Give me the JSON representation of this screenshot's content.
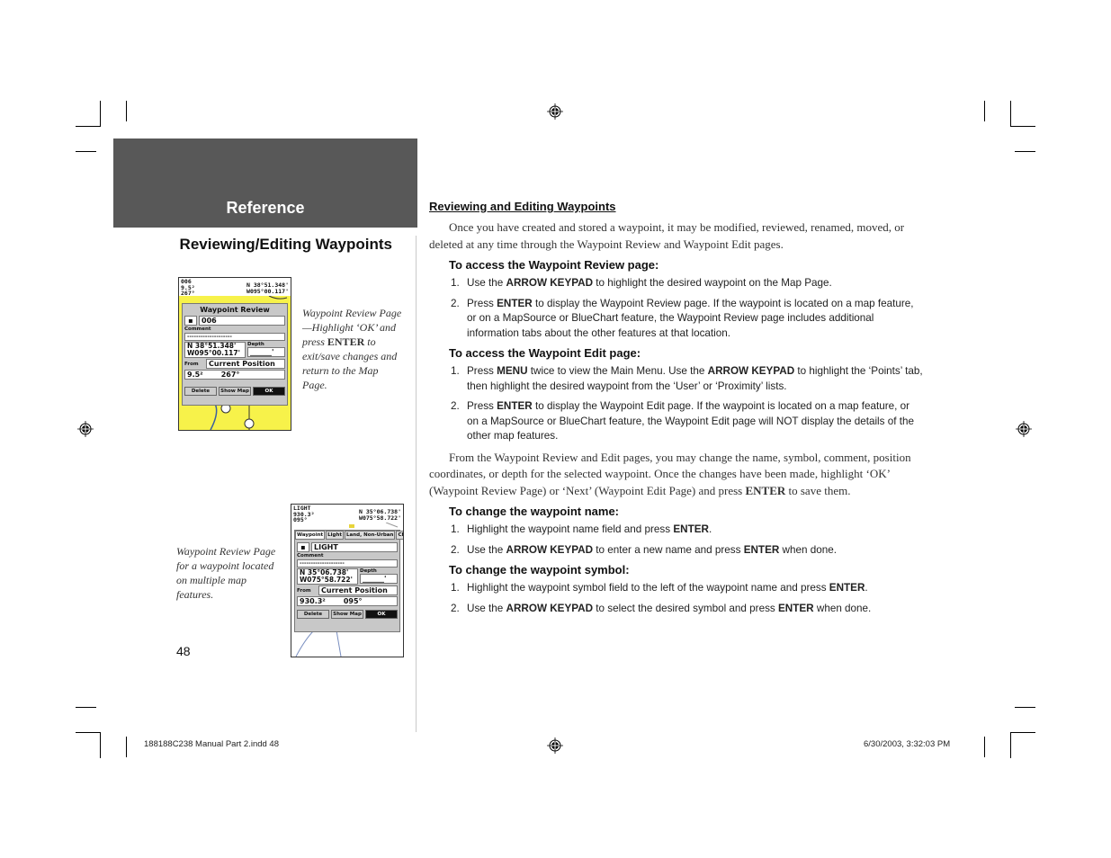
{
  "section_tab": {
    "label": "Reference"
  },
  "sidebar": {
    "heading": "Reviewing/Editing Waypoints",
    "figures": [
      {
        "caption_parts": [
          "Waypoint Review Page—Highlight ‘OK’ and press ",
          "ENTER",
          " to exit/save changes and return to the Map Page."
        ],
        "screen": {
          "header_left": [
            "006",
            "9.5²",
            "267°"
          ],
          "header_right": [
            "N 38°51.348'",
            "W095°00.117'"
          ],
          "title": "Waypoint Review",
          "symbol": "▪",
          "name": "006",
          "comment_label": "Comment",
          "comment_value": "--------------------",
          "coord_lat": "N  38°51.348'",
          "coord_lon": "W095°00.117'",
          "depth_label": "Depth",
          "depth_value": "______'",
          "from_label": "From",
          "from_value": "Current Position",
          "distance": "9.5²",
          "bearing": "267°",
          "buttons": [
            "Delete",
            "Show Map",
            "OK"
          ],
          "map_color": "#f7f24a"
        }
      },
      {
        "caption": "Waypoint Review Page for a waypoint located on multiple map features.",
        "screen": {
          "header_left": [
            "LIGHT",
            "930.3²",
            "095°"
          ],
          "header_right": [
            "N 35°06.738'",
            "W075°58.722'"
          ],
          "tabs": [
            "Waypoint",
            "Light",
            "Land, Non-Urban",
            "Chart L"
          ],
          "symbol": "▪",
          "name": "LIGHT",
          "comment_label": "Comment",
          "comment_value": "--------------------",
          "coord_lat": "N  35°06.738'",
          "coord_lon": "W075°58.722'",
          "depth_label": "Depth",
          "depth_value": "______'",
          "from_label": "From",
          "from_value": "Current Position",
          "distance": "930.3²",
          "bearing": "095°",
          "buttons": [
            "Delete",
            "Show Map",
            "OK"
          ],
          "map_color": "#ffffff"
        }
      }
    ],
    "page_number": "48"
  },
  "main": {
    "title": "Reviewing and Editing Waypoints",
    "intro": "Once you have created and stored a waypoint, it may be modified, reviewed, renamed, moved, or deleted at any time through the Waypoint Review and Waypoint Edit pages.",
    "sections": [
      {
        "heading": "To access the Waypoint Review page:",
        "steps": [
          [
            "Use the ",
            "ARROW KEYPAD",
            " to highlight the desired waypoint on the Map Page."
          ],
          [
            "Press ",
            "ENTER",
            " to display the Waypoint Review page. If the waypoint is located on a map feature, or on a MapSource or BlueChart feature, the Waypoint Review page includes additional information tabs about the other features at that location."
          ]
        ]
      },
      {
        "heading": "To access the Waypoint Edit page:",
        "steps": [
          [
            "Press ",
            "MENU",
            " twice to view the Main Menu. Use the ",
            "ARROW KEYPAD",
            " to highlight the ‘Points’ tab, then highlight the desired waypoint from the ‘User’ or ‘Proximity’ lists."
          ],
          [
            "Press ",
            "ENTER",
            " to display the Waypoint Edit page. If the waypoint is located on a map feature, or on a MapSource or BlueChart feature, the Waypoint Edit page will NOT display the details of the other map features."
          ]
        ]
      }
    ],
    "middle_paragraph": [
      "From the Waypoint Review and Edit pages, you may change the name, symbol, comment, position coordinates, or depth for the selected waypoint. Once the changes have been made, highlight ‘OK’ (Waypoint Review Page) or ‘Next’ (Waypoint Edit Page) and press ",
      "ENTER",
      " to save them."
    ],
    "sections2": [
      {
        "heading": "To change the waypoint name:",
        "steps": [
          [
            "Highlight the waypoint name field and press ",
            "ENTER",
            "."
          ],
          [
            "Use the ",
            "ARROW KEYPAD",
            " to enter a new name and press ",
            "ENTER",
            " when done."
          ]
        ]
      },
      {
        "heading": "To change the waypoint symbol:",
        "steps": [
          [
            "Highlight the waypoint symbol field to the left of the waypoint name and press ",
            "ENTER",
            "."
          ],
          [
            "Use the ",
            "ARROW KEYPAD",
            " to select the desired symbol and press ",
            "ENTER",
            " when done."
          ]
        ]
      }
    ]
  },
  "footer": {
    "file": "188188C238 Manual Part 2.indd   48",
    "timestamp": "6/30/2003, 3:32:03 PM"
  },
  "colors": {
    "tab_band": "#585858",
    "tab_text": "#ffffff"
  },
  "icons": [
    "registration-mark-icon",
    "crop-mark-icon"
  ]
}
